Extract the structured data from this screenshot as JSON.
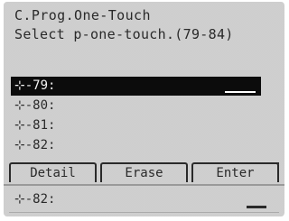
{
  "screen": {
    "title": "C.Prog.One-Touch",
    "prompt": "Select p-one-touch.(79-84)"
  },
  "entries": [
    {
      "label": "⊹-79:",
      "selected": true
    },
    {
      "label": "⊹-80:",
      "selected": false
    },
    {
      "label": "⊹-81:",
      "selected": false
    },
    {
      "label": "⊹-82:",
      "selected": false
    }
  ],
  "softkeys": {
    "detail": "Detail",
    "erase": "Erase",
    "enter": "Enter"
  },
  "ghost_entry": "⊹-82:",
  "colors": {
    "lcd_background": "#dfdfdf",
    "text": "#2a2a2a",
    "selection": "#0c0c0c"
  }
}
